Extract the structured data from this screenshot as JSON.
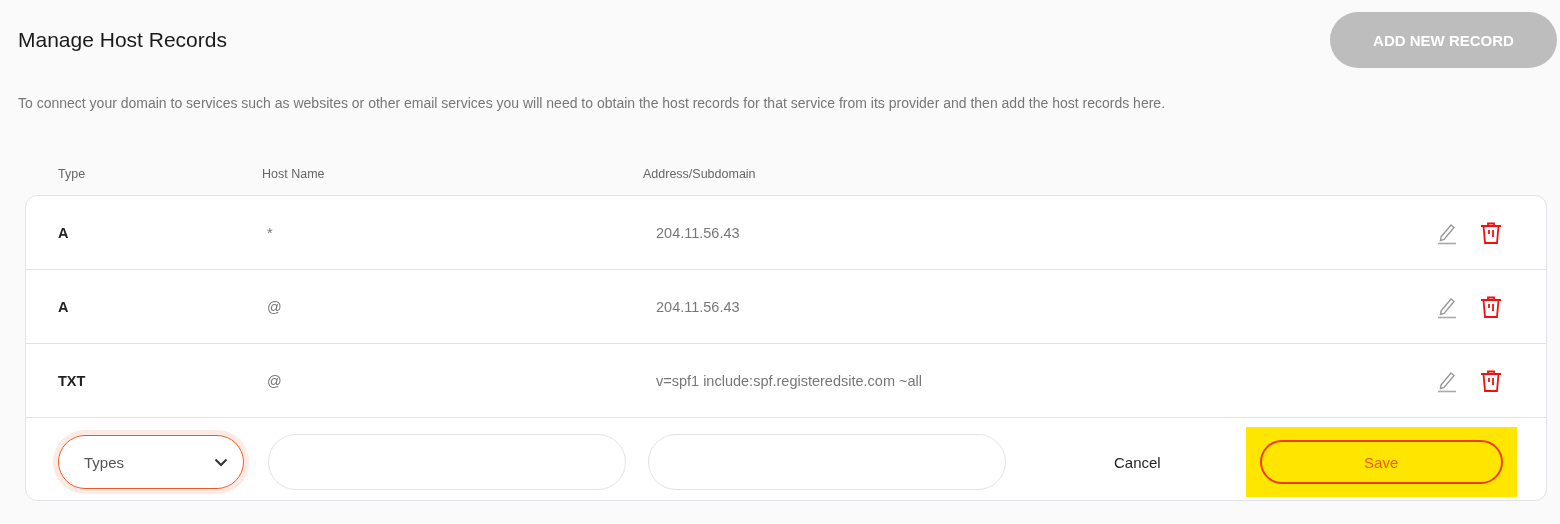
{
  "title": "Manage Host Records",
  "add_button": {
    "label": "ADD NEW RECORD",
    "disabled": true
  },
  "description": "To connect your domain to services such as websites or other email services you will need to obtain the host records for that service from its provider and then add the host records here.",
  "table": {
    "columns": [
      "Type",
      "Host Name",
      "Address/Subdomain"
    ],
    "rows": [
      {
        "type": "A",
        "host": "*",
        "address": "204.11.56.43"
      },
      {
        "type": "A",
        "host": "@",
        "address": "204.11.56.43"
      },
      {
        "type": "TXT",
        "host": "@",
        "address": "v=spf1 include:spf.registeredsite.com ~all"
      }
    ]
  },
  "new_record": {
    "type_select": {
      "placeholder": "Types",
      "focused": true
    },
    "cancel": "Cancel",
    "save": {
      "label": "Save",
      "highlighted": true
    }
  }
}
